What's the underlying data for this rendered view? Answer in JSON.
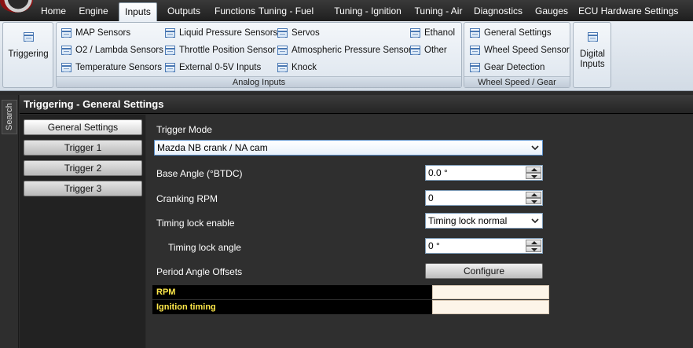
{
  "menu": {
    "tabs": [
      "Home",
      "Engine",
      "Inputs",
      "Outputs",
      "Functions",
      "Tuning - Fuel",
      "Tuning - Ignition",
      "Tuning - Air",
      "Diagnostics",
      "Gauges",
      "ECU Hardware Settings"
    ],
    "active": "Inputs"
  },
  "ribbon": {
    "triggering": "Triggering",
    "analog": {
      "label": "Analog Inputs",
      "items": [
        "MAP Sensors",
        "O2 / Lambda Sensors",
        "Temperature Sensors",
        "Liquid Pressure Sensors",
        "Throttle Position Sensor",
        "External 0-5V Inputs",
        "Servos",
        "Atmospheric Pressure Sensor",
        "Knock",
        "Ethanol",
        "Other"
      ]
    },
    "wheel": {
      "label": "Wheel Speed / Gear",
      "items": [
        "General Settings",
        "Wheel Speed Sensor",
        "Gear Detection"
      ]
    },
    "digital": {
      "line1": "Digital",
      "line2": "Inputs"
    }
  },
  "search": {
    "label": "Search"
  },
  "page": {
    "title": "Triggering - General Settings"
  },
  "nav": {
    "items": [
      "General Settings",
      "Trigger 1",
      "Trigger 2",
      "Trigger 3"
    ],
    "active": "General Settings"
  },
  "form": {
    "trigger_mode_label": "Trigger Mode",
    "trigger_mode_value": "Mazda NB crank / NA cam",
    "base_angle_label": "Base Angle (°BTDC)",
    "base_angle_value": "0.0 °",
    "cranking_rpm_label": "Cranking RPM",
    "cranking_rpm_value": "0",
    "timing_lock_enable_label": "Timing lock enable",
    "timing_lock_enable_value": "Timing lock normal",
    "timing_lock_angle_label": "Timing lock angle",
    "timing_lock_angle_value": "0 °",
    "period_offsets_label": "Period Angle Offsets",
    "configure_label": "Configure"
  },
  "offsets": {
    "rpm_label": "RPM",
    "ignition_label": "Ignition timing"
  },
  "colors": {
    "accent": "#ffe94a",
    "ribbon_bg": "#dde5ee",
    "content_bg": "#2f2f2f"
  }
}
